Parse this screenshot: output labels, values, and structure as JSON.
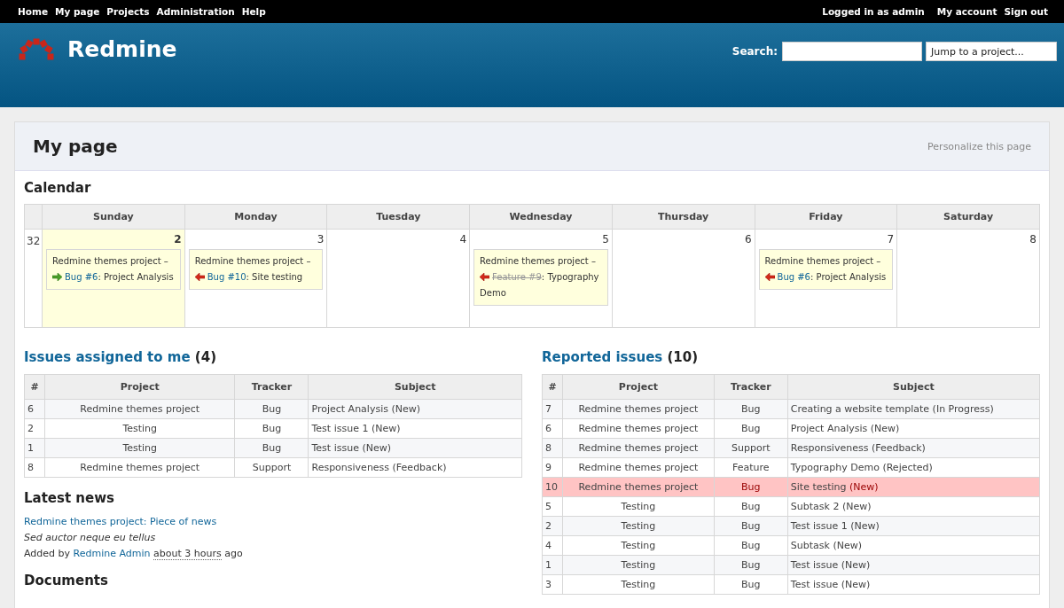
{
  "top_menu": {
    "items": [
      "Home",
      "My page",
      "Projects",
      "Administration",
      "Help"
    ],
    "account": {
      "logged_in": "Logged in as admin",
      "links": [
        "My account",
        "Sign out"
      ]
    }
  },
  "header": {
    "title": "Redmine",
    "search_label": "Search:",
    "jump_placeholder": "Jump to a project..."
  },
  "page": {
    "title": "My page",
    "personalize": "Personalize this page"
  },
  "calendar": {
    "title": "Calendar",
    "weekdays": [
      "Sunday",
      "Monday",
      "Tuesday",
      "Wednesday",
      "Thursday",
      "Friday",
      "Saturday"
    ],
    "weeks": [
      {
        "number": "32",
        "days": [
          {
            "day": "2",
            "today": true,
            "events": [
              {
                "project": "Redmine themes project –",
                "kind": "start",
                "link": "Bug #6",
                "closed": false,
                "subject": ": Project Analysis"
              }
            ]
          },
          {
            "day": "3",
            "today": false,
            "events": [
              {
                "project": "Redmine themes project –",
                "kind": "end",
                "link": "Bug #10",
                "closed": false,
                "subject": ": Site testing"
              }
            ]
          },
          {
            "day": "4",
            "today": false
          },
          {
            "day": "5",
            "today": false,
            "events": [
              {
                "project": "Redmine themes project –",
                "kind": "end",
                "link": "Feature #9",
                "closed": true,
                "subject": ": Typography Demo"
              }
            ]
          },
          {
            "day": "6",
            "today": false
          },
          {
            "day": "7",
            "today": false,
            "events": [
              {
                "project": "Redmine themes project –",
                "kind": "end",
                "link": "Bug #6",
                "closed": false,
                "subject": ": Project Analysis"
              }
            ]
          },
          {
            "day": "8",
            "today": false
          }
        ]
      }
    ]
  },
  "assigned": {
    "title": "Issues assigned to me",
    "count": "(4)",
    "columns": [
      "#",
      "Project",
      "Tracker",
      "Subject"
    ],
    "rows": [
      {
        "id": "6",
        "project": "Redmine themes project",
        "tracker": "Bug",
        "subject": "Project Analysis",
        "status": "(New)",
        "high_priority": false
      },
      {
        "id": "2",
        "project": "Testing",
        "tracker": "Bug",
        "subject": "Test issue 1",
        "status": "(New)",
        "high_priority": false
      },
      {
        "id": "1",
        "project": "Testing",
        "tracker": "Bug",
        "subject": "Test issue",
        "status": "(New)",
        "high_priority": false
      },
      {
        "id": "8",
        "project": "Redmine themes project",
        "tracker": "Support",
        "subject": "Responsiveness",
        "status": "(Feedback)",
        "high_priority": false
      }
    ]
  },
  "news": {
    "title": "Latest news",
    "items": [
      {
        "link": "Redmine themes project: Piece of news",
        "summary": "Sed auctor neque eu tellus",
        "added_by": "Added by",
        "author": "Redmine Admin",
        "time": "about 3 hours",
        "ago": "ago"
      }
    ]
  },
  "documents": {
    "title": "Documents"
  },
  "reported": {
    "title": "Reported issues",
    "count": "(10)",
    "columns": [
      "#",
      "Project",
      "Tracker",
      "Subject"
    ],
    "rows": [
      {
        "id": "7",
        "project": "Redmine themes project",
        "tracker": "Bug",
        "subject": "Creating a website template",
        "status": "(In Progress)",
        "high_priority": false
      },
      {
        "id": "6",
        "project": "Redmine themes project",
        "tracker": "Bug",
        "subject": "Project Analysis",
        "status": "(New)",
        "high_priority": false
      },
      {
        "id": "8",
        "project": "Redmine themes project",
        "tracker": "Support",
        "subject": "Responsiveness",
        "status": "(Feedback)",
        "high_priority": false
      },
      {
        "id": "9",
        "project": "Redmine themes project",
        "tracker": "Feature",
        "subject": "Typography Demo",
        "status": "(Rejected)",
        "high_priority": false
      },
      {
        "id": "10",
        "project": "Redmine themes project",
        "tracker": "Bug",
        "subject": "Site testing",
        "status": "(New)",
        "high_priority": true
      },
      {
        "id": "5",
        "project": "Testing",
        "tracker": "Bug",
        "subject": "Subtask 2",
        "status": "(New)",
        "high_priority": false
      },
      {
        "id": "2",
        "project": "Testing",
        "tracker": "Bug",
        "subject": "Test issue 1",
        "status": "(New)",
        "high_priority": false
      },
      {
        "id": "4",
        "project": "Testing",
        "tracker": "Bug",
        "subject": "Subtask",
        "status": "(New)",
        "high_priority": false
      },
      {
        "id": "1",
        "project": "Testing",
        "tracker": "Bug",
        "subject": "Test issue",
        "status": "(New)",
        "high_priority": false
      },
      {
        "id": "3",
        "project": "Testing",
        "tracker": "Bug",
        "subject": "Test issue",
        "status": "(New)",
        "high_priority": false
      }
    ]
  }
}
